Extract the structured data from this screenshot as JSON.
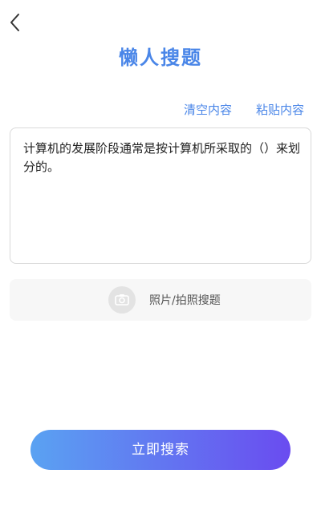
{
  "header": {
    "back_icon": "chevron-left-icon",
    "title": "懒人搜题"
  },
  "actions": {
    "clear_label": "清空内容",
    "paste_label": "粘贴内容"
  },
  "question": {
    "value": "计算机的发展阶段通常是按计算机所采取的（）来划分的。"
  },
  "photo": {
    "icon": "camera-icon",
    "label": "照片/拍照搜题"
  },
  "search": {
    "label": "立即搜索"
  },
  "colors": {
    "accent": "#4a86e8",
    "button_gradient_start": "#5aa2f2",
    "button_gradient_end": "#6a4cf0"
  }
}
